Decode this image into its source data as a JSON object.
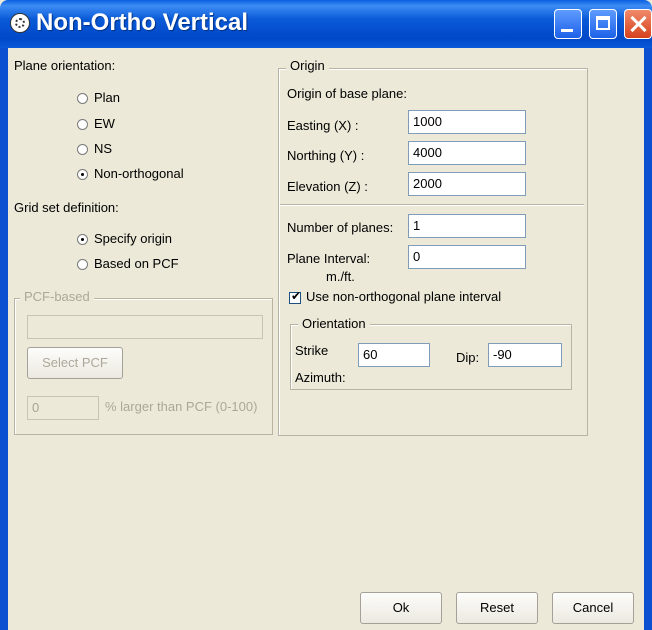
{
  "window": {
    "title": "Non-Ortho Vertical"
  },
  "plane_orientation": {
    "label": "Plane orientation:",
    "options": [
      "Plan",
      "EW",
      "NS",
      "Non-orthogonal"
    ],
    "selected": "Non-orthogonal"
  },
  "grid_set": {
    "label": "Grid set definition:",
    "options": [
      "Specify origin",
      "Based on PCF"
    ],
    "selected": "Specify origin"
  },
  "pcf_group": {
    "title": "PCF-based",
    "pcf_value": "",
    "select_button": "Select PCF",
    "larger_value": "0",
    "larger_label": "% larger than PCF (0-100)"
  },
  "origin_group": {
    "title": "Origin",
    "subtitle": "Origin of base plane:",
    "easting_label": "Easting (X) :",
    "easting_value": "1000",
    "northing_label": "Northing (Y) :",
    "northing_value": "4000",
    "elevation_label": "Elevation (Z) :",
    "elevation_value": "2000",
    "num_planes_label": "Number of planes:",
    "num_planes_value": "1",
    "interval_label": "Plane Interval:",
    "interval_value": "0",
    "interval_unit": "m./ft.",
    "use_nonortho_label": "Use non-orthogonal plane interval",
    "use_nonortho_checked": true
  },
  "orientation_group": {
    "title": "Orientation",
    "strike_label": "Strike",
    "strike_value": "60",
    "azimuth_label": "Azimuth:",
    "dip_label": "Dip:",
    "dip_value": "-90"
  },
  "buttons": {
    "ok": "Ok",
    "reset": "Reset",
    "cancel": "Cancel"
  }
}
